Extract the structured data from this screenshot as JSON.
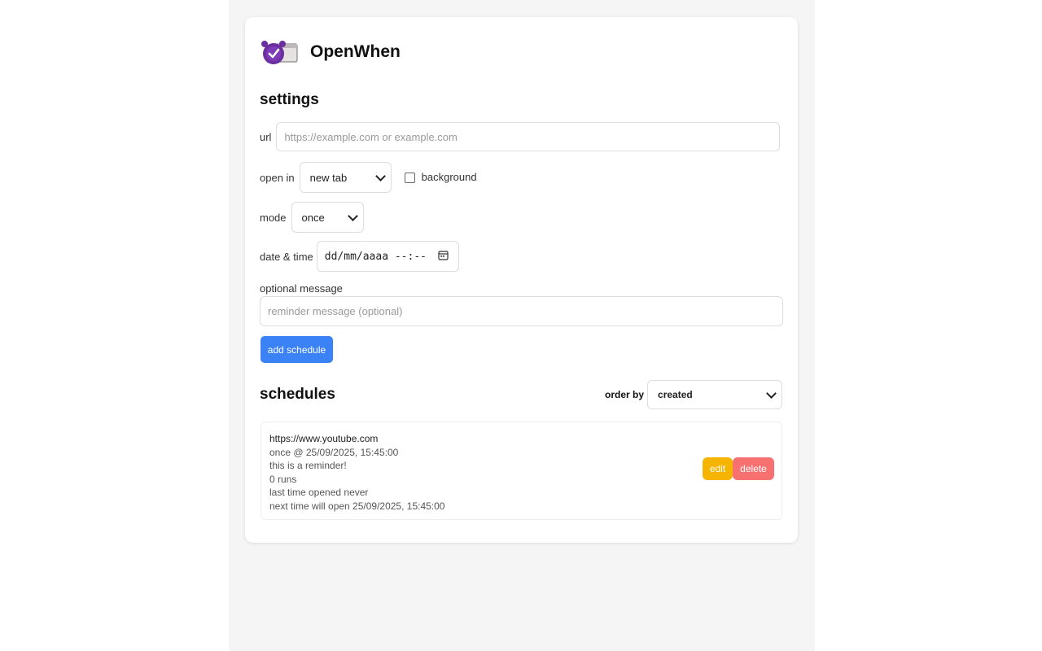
{
  "app": {
    "title": "OpenWhen"
  },
  "settings": {
    "heading": "settings",
    "url": {
      "label": "url",
      "value": "",
      "placeholder": "https://example.com or example.com"
    },
    "open_in": {
      "label": "open in",
      "selected": "new tab",
      "background_label": "background",
      "background_checked": false
    },
    "mode": {
      "label": "mode",
      "selected": "once"
    },
    "datetime": {
      "label": "date & time",
      "value": "dd/mm/aaaa --:--"
    },
    "message": {
      "label": "optional message",
      "value": "",
      "placeholder": "reminder message (optional)"
    },
    "add_button": "add schedule"
  },
  "schedules": {
    "heading": "schedules",
    "order_by": {
      "label": "order by",
      "selected": "created"
    },
    "items": [
      {
        "url": "https://www.youtube.com",
        "when": "once @ 25/09/2025, 15:45:00",
        "message": "this is a reminder!",
        "runs": "0 runs",
        "last_opened": "last time opened never",
        "next_open": "next time will open 25/09/2025, 15:45:00",
        "edit_label": "edit",
        "delete_label": "delete"
      }
    ]
  },
  "colors": {
    "primary": "#3b82f6",
    "edit": "#f5b400",
    "delete": "#f87171",
    "logo": "#6b2fa0"
  },
  "icons": {
    "logo": "alarm-clock-calendar-icon",
    "calendar": "calendar-icon",
    "chevron": "chevron-down-icon",
    "checkbox": "checkbox-icon"
  }
}
